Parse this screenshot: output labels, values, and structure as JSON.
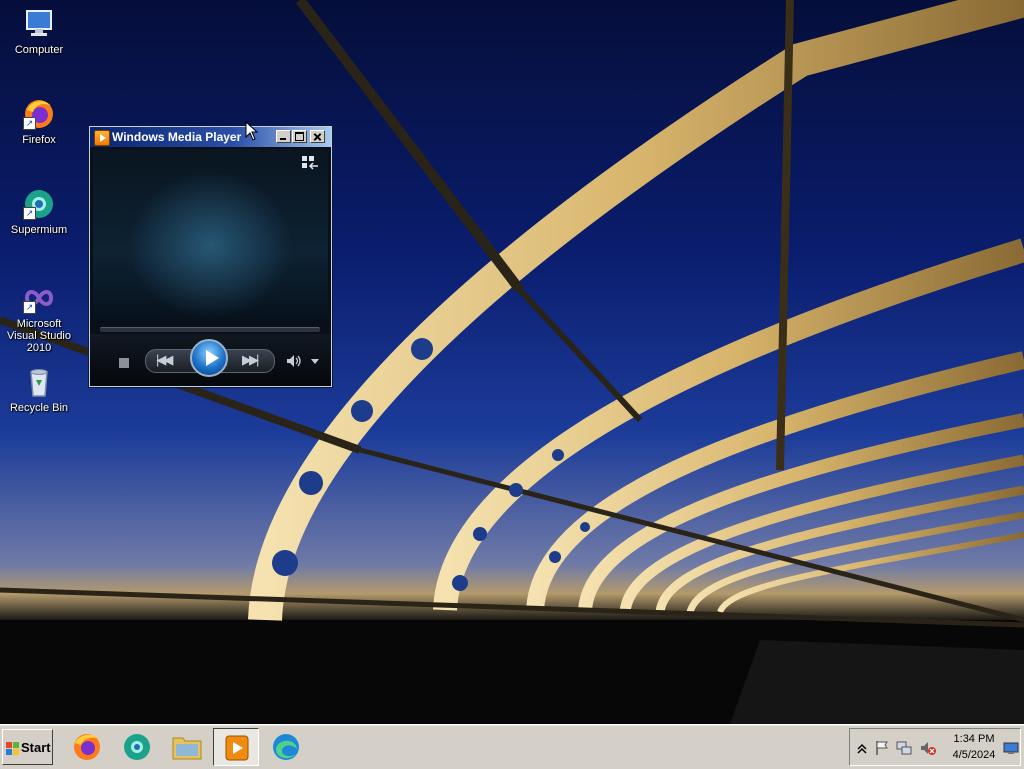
{
  "desktop": {
    "icons": [
      {
        "label": "Computer"
      },
      {
        "label": "Firefox"
      },
      {
        "label": "Supermium"
      },
      {
        "label": "Microsoft Visual Studio 2010"
      },
      {
        "label": "Recycle Bin"
      }
    ]
  },
  "media_player": {
    "title": "Windows Media Player",
    "controls": [
      "stop",
      "previous",
      "play",
      "next",
      "volume",
      "volume-menu"
    ]
  },
  "taskbar": {
    "start_label": "Start",
    "pinned": [
      {
        "icon": "firefox-icon"
      },
      {
        "icon": "supermium-icon"
      },
      {
        "icon": "file-explorer-icon"
      },
      {
        "icon": "windows-media-player-icon",
        "active": true
      },
      {
        "icon": "edge-icon"
      }
    ],
    "tray": {
      "icons": [
        "show-hidden-icons",
        "action-center-flag-icon",
        "network-icon",
        "volume-muted-icon",
        "show-desktop-icon"
      ],
      "time": "1:34 PM",
      "date": "4/5/2024"
    }
  },
  "colors": {
    "taskbar": "#d4d0c8",
    "titlebar_start": "#0a2470",
    "titlebar_end": "#a6caf0",
    "play_button": "#1c72c8"
  }
}
